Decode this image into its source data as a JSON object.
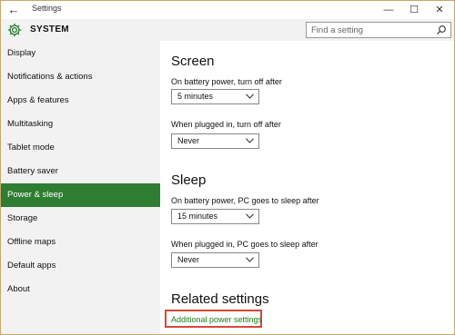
{
  "window": {
    "title": "Settings",
    "back_glyph": "←",
    "minimize_glyph": "—",
    "maximize_glyph": "☐",
    "close_glyph": "✕"
  },
  "header": {
    "title": "SYSTEM",
    "search_placeholder": "Find a setting",
    "icon": "gear-icon"
  },
  "sidebar": {
    "items": [
      {
        "label": "Display"
      },
      {
        "label": "Notifications & actions"
      },
      {
        "label": "Apps & features"
      },
      {
        "label": "Multitasking"
      },
      {
        "label": "Tablet mode"
      },
      {
        "label": "Battery saver"
      },
      {
        "label": "Power & sleep",
        "active": true
      },
      {
        "label": "Storage"
      },
      {
        "label": "Offline maps"
      },
      {
        "label": "Default apps"
      },
      {
        "label": "About"
      }
    ]
  },
  "screen": {
    "heading": "Screen",
    "battery_label": "On battery power, turn off after",
    "battery_value": "5 minutes",
    "plugged_label": "When plugged in, turn off after",
    "plugged_value": "Never"
  },
  "sleep": {
    "heading": "Sleep",
    "battery_label": "On battery power, PC goes to sleep after",
    "battery_value": "15 minutes",
    "plugged_label": "When plugged in, PC goes to sleep after",
    "plugged_value": "Never"
  },
  "related": {
    "heading": "Related settings",
    "link_label": "Additional power settings"
  },
  "colors": {
    "accent": "#2e7d32",
    "link": "#1a7f1a",
    "highlight_border": "#d04a3a"
  }
}
